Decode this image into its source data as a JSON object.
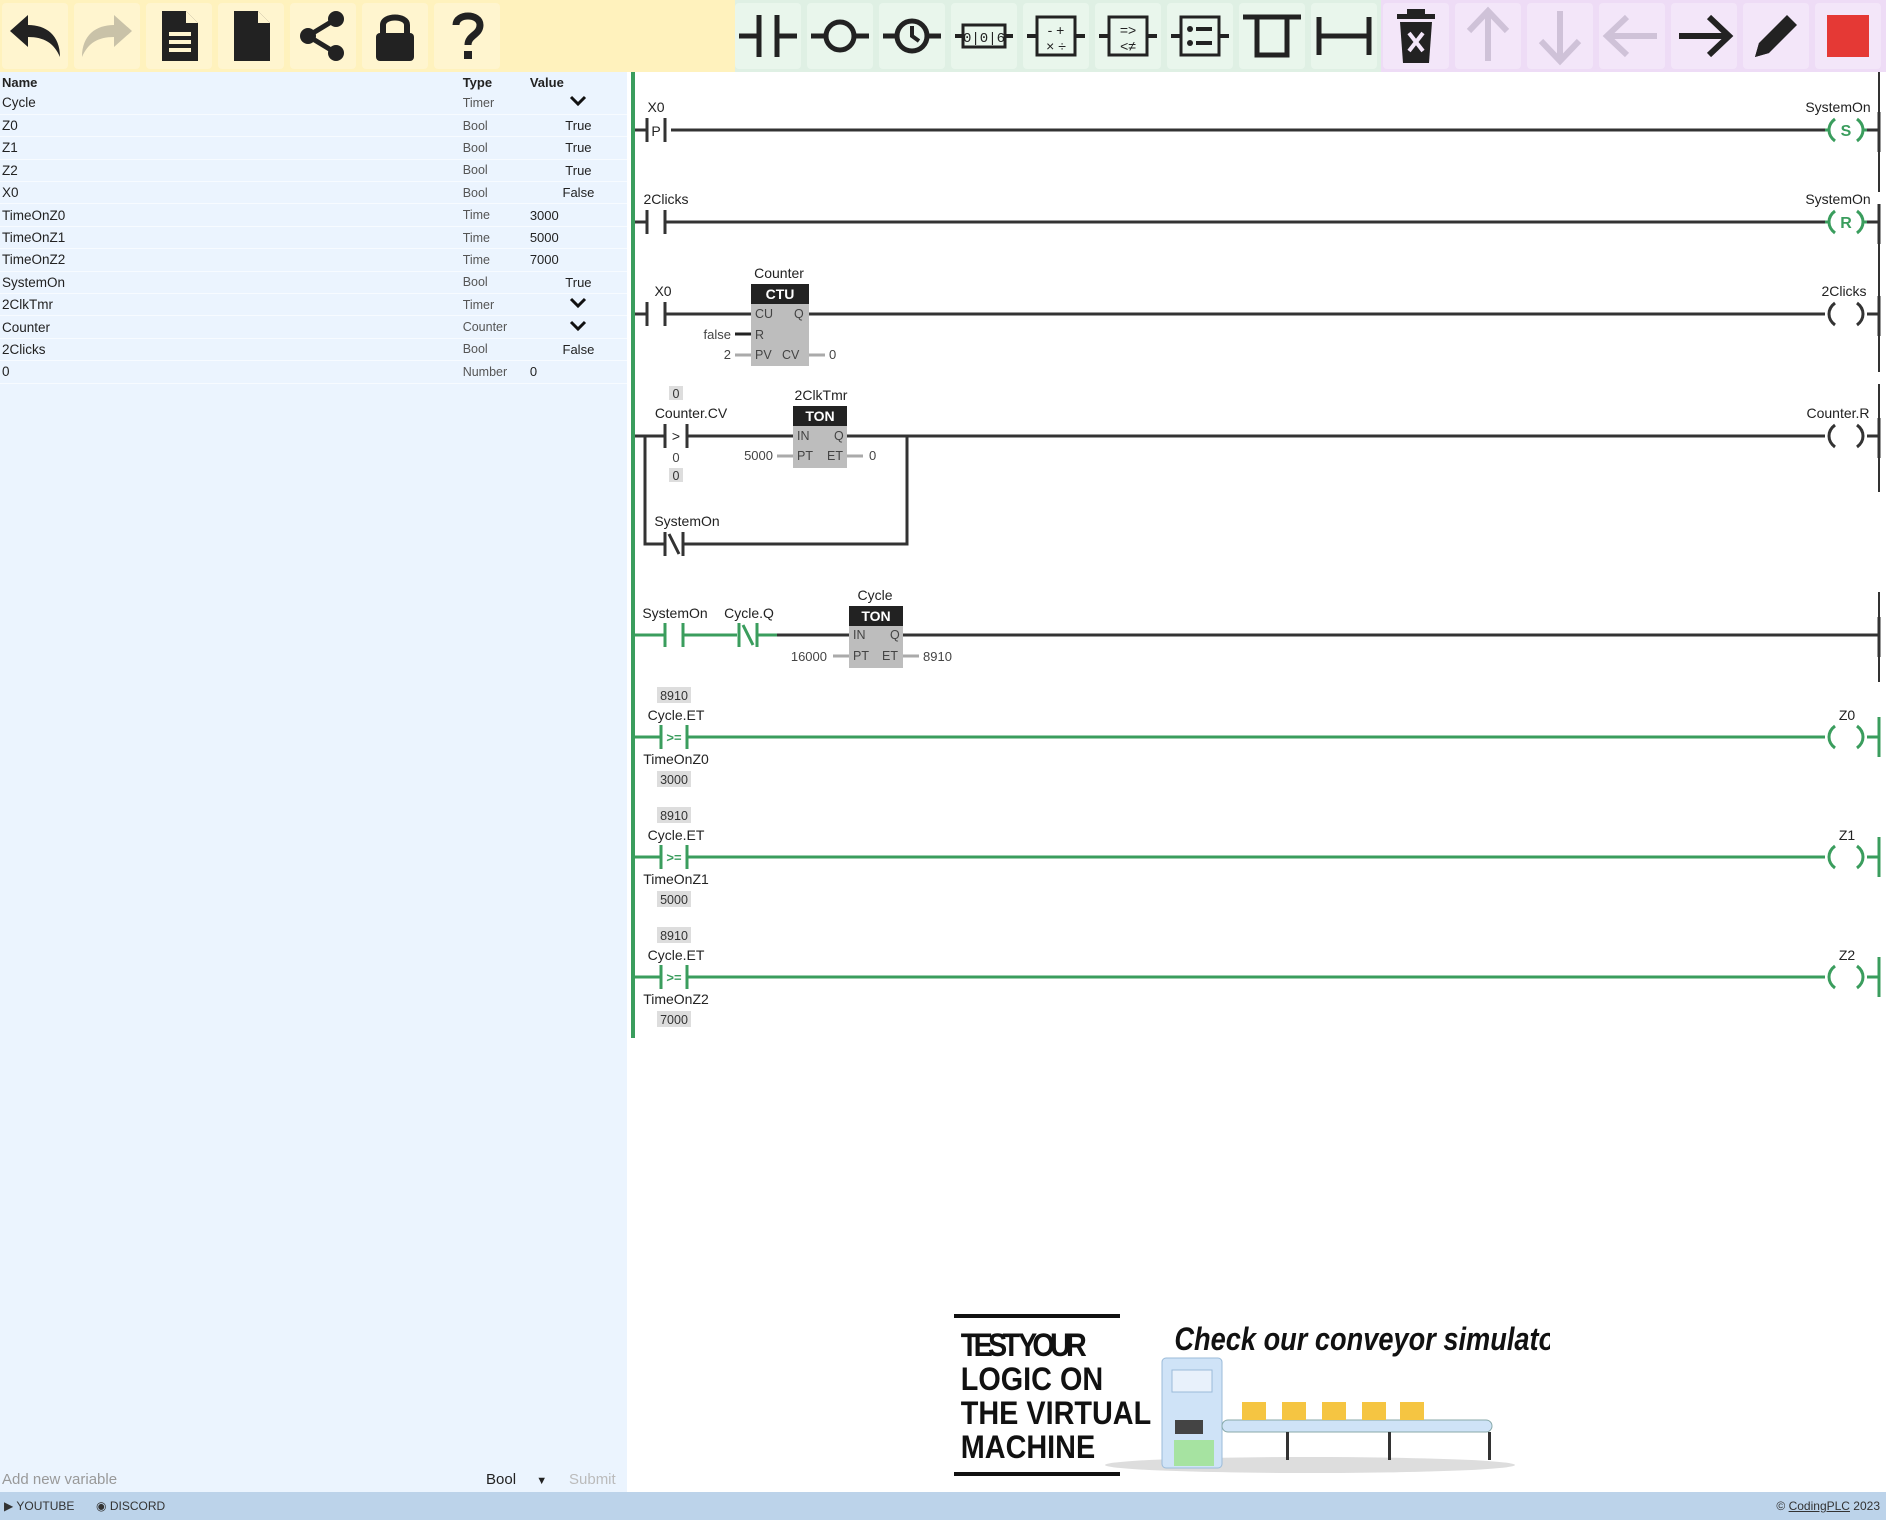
{
  "colors": {
    "toolbar_yellow": "#fff2bd",
    "toolbar_green": "#dff0e4",
    "toolbar_purple": "#eedcf6",
    "energized": "#3a9d5d",
    "wire": "#333333",
    "stop": "#e53935"
  },
  "toolbar": {
    "file_icons": [
      "undo-icon",
      "redo-icon",
      "document-lines-icon",
      "new-file-icon",
      "share-icon",
      "lock-icon",
      "help-icon"
    ],
    "element_icons": [
      "contact-icon",
      "coil-icon",
      "timer-icon",
      "counter-icon",
      "math-icon",
      "compare-icon",
      "list-icon",
      "branch-icon",
      "wire-icon"
    ],
    "edit_icons": [
      "delete-icon",
      "arrow-up-icon",
      "arrow-down-icon",
      "arrow-left-icon",
      "arrow-right-icon",
      "pencil-icon",
      "stop-icon"
    ]
  },
  "variables": {
    "headers": {
      "name": "Name",
      "type": "Type",
      "value": "Value"
    },
    "rows": [
      {
        "name": "Cycle",
        "type": "Timer",
        "value": ""
      },
      {
        "name": "Z0",
        "type": "Bool",
        "value": "True"
      },
      {
        "name": "Z1",
        "type": "Bool",
        "value": "True"
      },
      {
        "name": "Z2",
        "type": "Bool",
        "value": "True"
      },
      {
        "name": "X0",
        "type": "Bool",
        "value": "False"
      },
      {
        "name": "TimeOnZ0",
        "type": "Time",
        "value": "3000"
      },
      {
        "name": "TimeOnZ1",
        "type": "Time",
        "value": "5000"
      },
      {
        "name": "TimeOnZ2",
        "type": "Time",
        "value": "7000"
      },
      {
        "name": "SystemOn",
        "type": "Bool",
        "value": "True"
      },
      {
        "name": "2ClkTmr",
        "type": "Timer",
        "value": ""
      },
      {
        "name": "Counter",
        "type": "Counter",
        "value": ""
      },
      {
        "name": "2Clicks",
        "type": "Bool",
        "value": "False"
      },
      {
        "name": "0",
        "type": "Number",
        "value": "0"
      }
    ],
    "add_placeholder": "Add new variable",
    "add_type": "Bool",
    "submit_label": "Submit"
  },
  "rungs": {
    "r1": {
      "contact": "X0",
      "contact_mark": "P",
      "coil": "SystemOn",
      "coil_mark": "S"
    },
    "r2": {
      "contact": "2Clicks",
      "coil": "SystemOn",
      "coil_mark": "R"
    },
    "r3": {
      "contact": "X0",
      "block_name": "Counter",
      "block_type": "CTU",
      "pin_cu": "CU",
      "pin_q": "Q",
      "pin_r": "R",
      "pin_pv": "PV",
      "pin_cv": "CV",
      "r_val": "false",
      "pv_val": "2",
      "cv_val": "0",
      "coil": "2Clicks"
    },
    "r4": {
      "cmp_top": "0",
      "cmp_var": "Counter.CV",
      "cmp_op": ">",
      "cmp_b": "0",
      "cmp_bot": "0",
      "block_name": "2ClkTmr",
      "block_type": "TON",
      "pin_in": "IN",
      "pin_q": "Q",
      "pin_pt": "PT",
      "pin_et": "ET",
      "pt_val": "5000",
      "et_val": "0",
      "branch_contact": "SystemOn",
      "coil": "Counter.R"
    },
    "r5": {
      "contact1": "SystemOn",
      "contact2": "Cycle.Q",
      "block_name": "Cycle",
      "block_type": "TON",
      "pin_in": "IN",
      "pin_q": "Q",
      "pin_pt": "PT",
      "pin_et": "ET",
      "pt_val": "16000",
      "et_val": "8910"
    },
    "r6": {
      "top": "8910",
      "var": "Cycle.ET",
      "op": ">=",
      "ref": "TimeOnZ0",
      "bot": "3000",
      "coil": "Z0"
    },
    "r7": {
      "top": "8910",
      "var": "Cycle.ET",
      "op": ">=",
      "ref": "TimeOnZ1",
      "bot": "5000",
      "coil": "Z1"
    },
    "r8": {
      "top": "8910",
      "var": "Cycle.ET",
      "op": ">=",
      "ref": "TimeOnZ2",
      "bot": "7000",
      "coil": "Z2"
    }
  },
  "promo": {
    "line1": "TEST YOUR",
    "line2": "LOGIC ON",
    "line3": "THE VIRTUAL",
    "line4": "MACHINE",
    "tagline": "Check our conveyor simulator!"
  },
  "footer": {
    "youtube": "YOUTUBE",
    "discord": "DISCORD",
    "copyright": "© ",
    "brand": "CodingPLC",
    "year": " 2023"
  }
}
